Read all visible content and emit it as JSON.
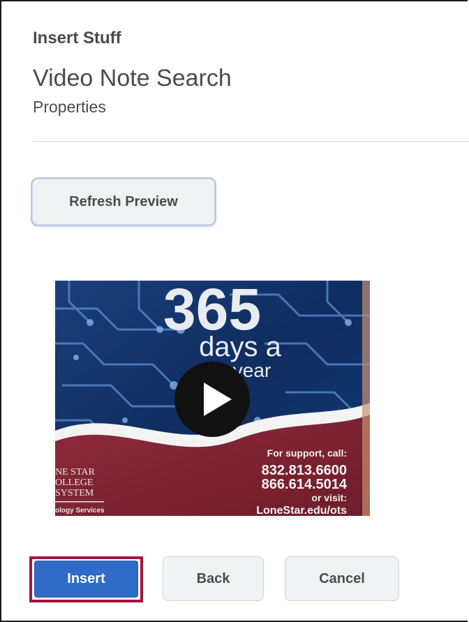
{
  "dialog": {
    "title": "Insert Stuff",
    "heading": "Video Note Search",
    "subheading": "Properties"
  },
  "preview": {
    "refresh_label": "Refresh Preview",
    "poster_text": {
      "big_number": "365",
      "days_line": "days a",
      "year_line": "year",
      "support_line": "For support, call:",
      "phone_1": "832.813.6600",
      "phone_2": "866.614.5014",
      "or_visit": "or visit:",
      "url": "LoneStar.edu/ots",
      "logo_line_1": "NE STAR",
      "logo_line_2": "OLLEGE",
      "logo_line_3": "SYSTEM",
      "logo_line_4": "ology Services"
    },
    "play_icon": "play-icon"
  },
  "actions": {
    "insert_label": "Insert",
    "back_label": "Back",
    "cancel_label": "Cancel"
  },
  "colors": {
    "primary": "#2f6bc7",
    "highlight_outline": "#a8123e",
    "text": "#494c4e",
    "secondary_button": "#f1f2f4"
  }
}
